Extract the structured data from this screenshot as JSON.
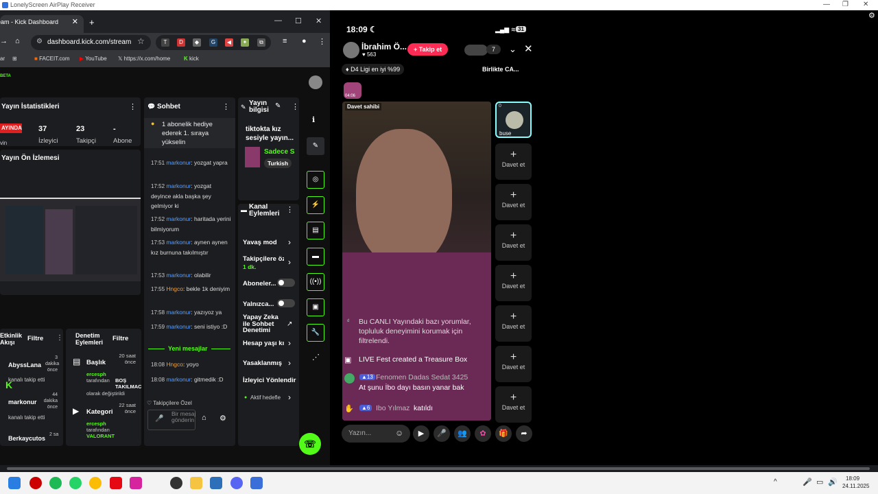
{
  "outer": {
    "title": "LonelyScreen AirPlay Receiver"
  },
  "browser": {
    "tab_title": "eam - Kick Dashboard",
    "url": "dashboard.kick.com/stream",
    "bookmarks": [
      "ar",
      "FACEIT.com",
      "YouTube",
      "https://x.com/home",
      "kick"
    ]
  },
  "stats": {
    "title": "Yayın İstatistikleri",
    "status": "AYINDA",
    "status_sub": "vin",
    "viewers": "37",
    "viewers_label": "İzleyici",
    "followers": "23",
    "followers_label": "Takipçi",
    "subs": "-",
    "subs_label": "Abone"
  },
  "preview": {
    "title": "Yayın Ön İzlemesi"
  },
  "activity": {
    "title": "Etkinlik Akışı",
    "filter": "Filtre",
    "items": [
      {
        "user": "AbyssLana",
        "action": "kanalı takip etti",
        "time": "3 dakika önce"
      },
      {
        "user": "markonur",
        "action": "kanalı takip etti",
        "time": "44 dakika önce"
      },
      {
        "user": "Berkaycutos",
        "action": "",
        "time": "2 sa"
      }
    ]
  },
  "moderation": {
    "title": "Denetim Eylemleri",
    "filter": "Filtre",
    "items": [
      {
        "label": "Başlık",
        "time": "20 saat önce",
        "by": "ercesph",
        "by_suffix": "tarafından",
        "value": "BOŞ TAKILMACA",
        "tail": "olarak değiştirildi"
      },
      {
        "label": "Kategori",
        "time": "22 saat önce",
        "by": "ercesph",
        "by_suffix": "tarafından",
        "value": "VALORANT",
        "tail": ""
      }
    ]
  },
  "chat": {
    "title": "Sohbet",
    "pinned": "1 abonelik hediye ederek 1. sıraya yükselin",
    "messages": [
      {
        "time": "17:51",
        "user": "markonur",
        "text": "yozgat yapra"
      },
      {
        "time": "17:52",
        "user": "markonur",
        "text": "yozgat deyince akla başka şey gelmiyor ki"
      },
      {
        "time": "17:52",
        "user": "markonur",
        "text": "haritada yerini bilmiyorum"
      },
      {
        "time": "17:53",
        "user": "markonur",
        "text": "aynen aynen kız burnuna takılmıştır"
      },
      {
        "time": "17:53",
        "user": "markonur",
        "text": "olabilir"
      },
      {
        "time": "17:55",
        "user": "Hngco",
        "text": "bekle 1k deniyim"
      },
      {
        "time": "17:58",
        "user": "markonur",
        "text": "yazıyoz ya"
      },
      {
        "time": "17:59",
        "user": "markonur",
        "text": "seni istiyo :D"
      },
      {
        "time": "18:08",
        "user": "Hngco",
        "text": "yoyo"
      },
      {
        "time": "18:08",
        "user": "markonur",
        "text": "gitmedik :D"
      }
    ],
    "new_messages": "Yeni mesajlar",
    "followers_only": "Takipçilere Özel",
    "input_placeholder": "Bir mesaj gönderin"
  },
  "stream_info": {
    "title": "Yayın bilgisi",
    "stream_title": "tiktokta kız sesiyle yayın...",
    "category": "Sadece S",
    "tag": "Turkish"
  },
  "channel_actions": {
    "title": "Kanal Eylemleri",
    "items": [
      "Yavaş mod",
      "Takipçilere öz",
      "Aboneler...",
      "Yalnızca...",
      "Yapay Zeka ile Sohbet Denetimi",
      "Hesap yaşı kı",
      "Yasaklanmış",
      "İzleyici Yönlendir"
    ],
    "followers_sub": "1 dk.",
    "active_label": "Aktif hedefle"
  },
  "phone": {
    "time": "18:09",
    "battery": "31",
    "host_name": "İbrahim Ö...",
    "host_likes": "563",
    "follow_label": "Takip et",
    "viewer_count": "7",
    "rank_badge": "D4 Ligi en iyi %99",
    "together_label": "Birlikte CA...",
    "gift_time": "04:06",
    "host_tag": "Davet sahibi",
    "guest_name": "buse",
    "guest_count": "0",
    "invite_label": "Davet et",
    "comments": [
      {
        "user": "",
        "text": "Bu CANLI Yayındaki bazı yorumlar, topluluk deneyimini korumak için filtrelendi."
      },
      {
        "user": "",
        "text": "LIVE Fest created a Treasure Box"
      },
      {
        "user": "Fenomen  Dadas Sedat 3425",
        "level": "13",
        "text": "At şunu İbo dayı basın yanar bak"
      },
      {
        "user": "Ibo Yılmaz",
        "level": "6",
        "text": "katıldı"
      }
    ],
    "input_placeholder": "Yazın..."
  },
  "taskbar": {
    "time": "18:09",
    "date": "24.11.2025"
  }
}
